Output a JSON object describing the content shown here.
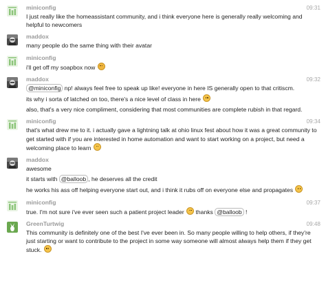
{
  "messages": [
    {
      "author": "miniconfig",
      "time": "09:31",
      "avatar": "bar-chart-avatar",
      "lines": [
        [
          {
            "t": "text",
            "v": "I just really like the homeassistant community, and i think everyone here is generally really welcoming and helpful to newcomers"
          }
        ]
      ]
    },
    {
      "author": "maddox",
      "time": "",
      "avatar": "photo-avatar",
      "lines": [
        [
          {
            "t": "text",
            "v": "many people do the same thing with their avatar"
          }
        ]
      ]
    },
    {
      "author": "miniconfig",
      "time": "",
      "avatar": "bar-chart-avatar",
      "lines": [
        [
          {
            "t": "text",
            "v": "i'll get off my soapbox now "
          },
          {
            "t": "emoji",
            "v": "worried-face-emoji"
          }
        ]
      ]
    },
    {
      "author": "maddox",
      "time": "09:32",
      "avatar": "photo-avatar",
      "lines": [
        [
          {
            "t": "mention",
            "v": "@miniconfig"
          },
          {
            "t": "text",
            "v": " np! always feel free to speak up like! everyone in here IS generally open to that critiscm."
          }
        ],
        [
          {
            "t": "text",
            "v": "its why i sorta of latched on too, there's a nice level of class in here "
          },
          {
            "t": "emoji",
            "v": "smile-emoji"
          }
        ],
        [
          {
            "t": "text",
            "v": "also, that's a very nice compliment, considering that most communities are complete rubish in that regard."
          }
        ]
      ]
    },
    {
      "author": "miniconfig",
      "time": "09:34",
      "avatar": "bar-chart-avatar",
      "lines": [
        [
          {
            "t": "text",
            "v": "that's what drew me to it. i actually gave a lightning talk at ohio linux fest about how it was a great community to get started with if you are interested in home automation and want to start working on a project, but need a welcoming place to learn "
          },
          {
            "t": "emoji",
            "v": "smile-emoji"
          }
        ]
      ]
    },
    {
      "author": "maddox",
      "time": "",
      "avatar": "photo-avatar",
      "lines": [
        [
          {
            "t": "text",
            "v": "awesome"
          }
        ],
        [
          {
            "t": "text",
            "v": "it starts with "
          },
          {
            "t": "mention",
            "v": "@balloob"
          },
          {
            "t": "text",
            "v": ", he deserves all the credit"
          }
        ],
        [
          {
            "t": "text",
            "v": "he works his ass off helping everyone start out, and i think it rubs off on everyone else and propagates "
          },
          {
            "t": "emoji",
            "v": "smile-emoji"
          }
        ]
      ]
    },
    {
      "author": "miniconfig",
      "time": "09:37",
      "avatar": "bar-chart-avatar",
      "lines": [
        [
          {
            "t": "text",
            "v": "true. I'm not sure i've ever seen such a patient project leader "
          },
          {
            "t": "emoji",
            "v": "smile-emoji"
          },
          {
            "t": "text",
            "v": " thanks "
          },
          {
            "t": "mention",
            "v": "@balloob"
          },
          {
            "t": "text",
            "v": " !"
          }
        ]
      ]
    },
    {
      "author": "GreenTurtwig",
      "time": "09:48",
      "avatar": "rabbit-avatar",
      "lines": [
        [
          {
            "t": "text",
            "v": "This community is definitely one of the best I've ever been in. So many people willing to help others, if they're just starting or want to contribute to the project in some way someone will almost always help them if they get stuck. "
          },
          {
            "t": "emoji",
            "v": "smile-emoji"
          }
        ]
      ]
    }
  ],
  "colors": {
    "author": "#9a9a9a",
    "bar_green": "#8cc57a",
    "rabbit_green": "#6aa84f"
  }
}
